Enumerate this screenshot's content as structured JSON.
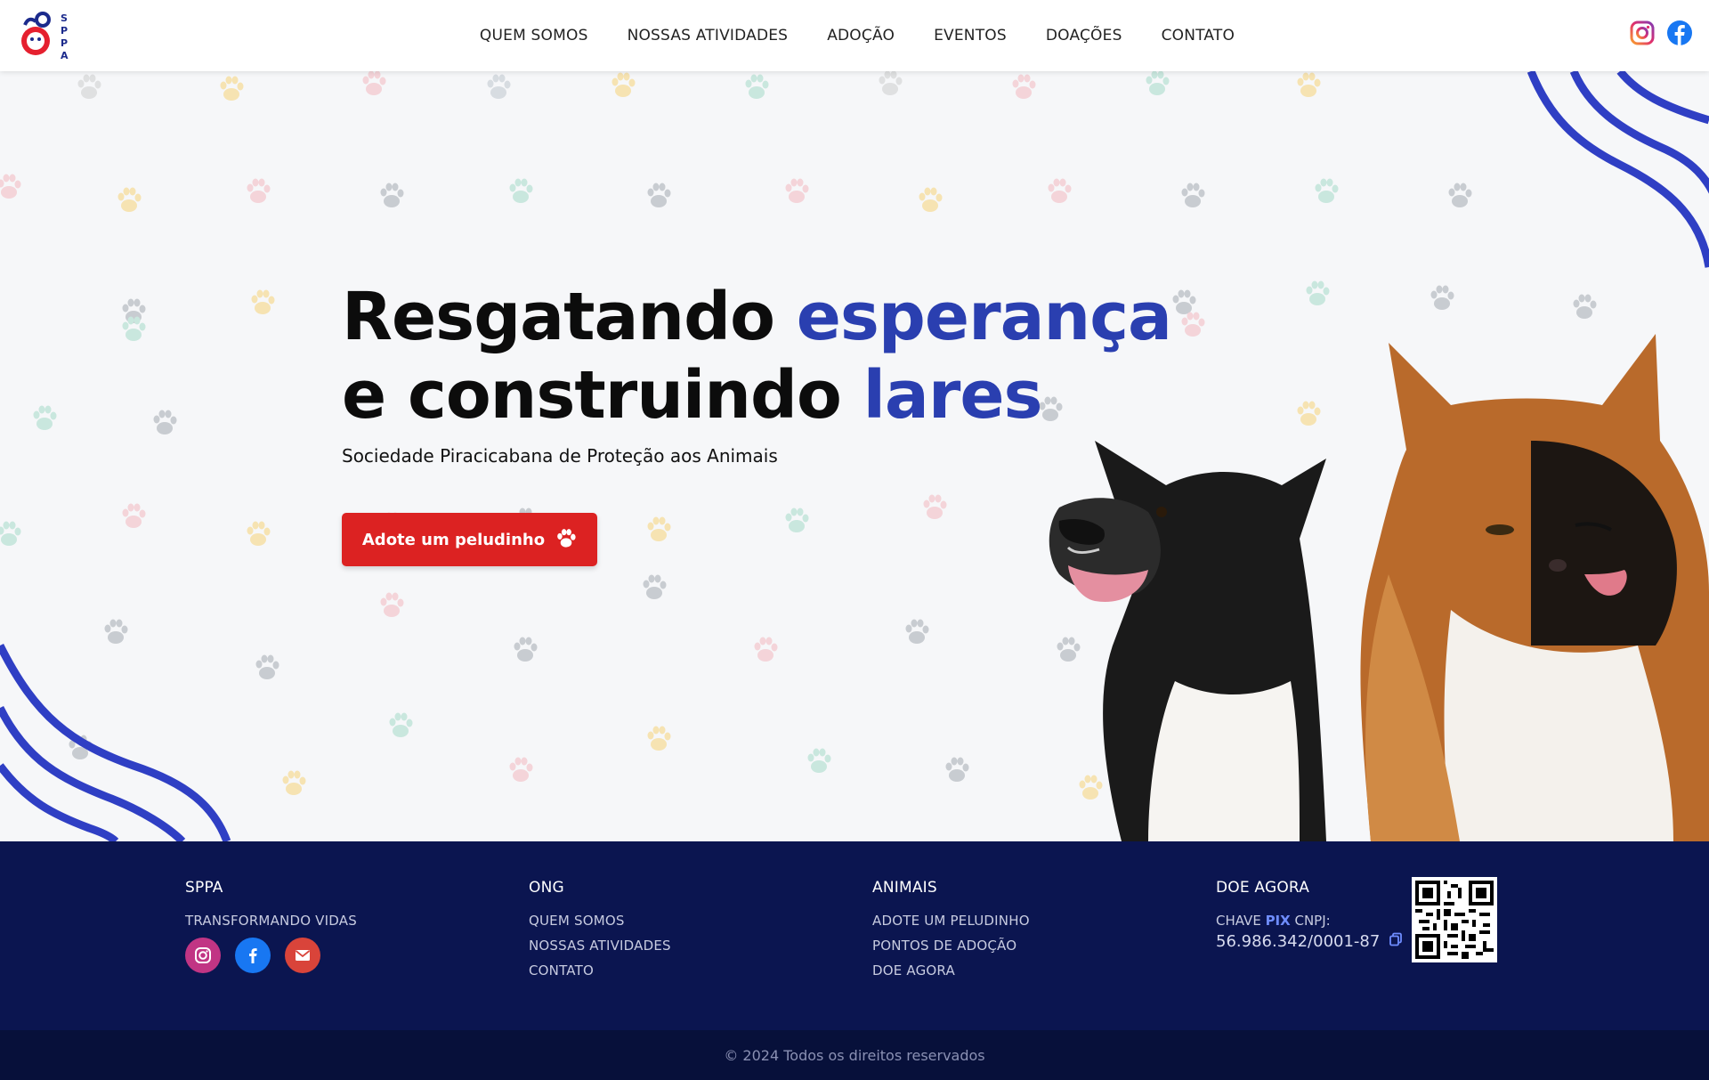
{
  "header": {
    "logo_letters": "SPPA",
    "nav": [
      {
        "label": "QUEM SOMOS"
      },
      {
        "label": "NOSSAS ATIVIDADES"
      },
      {
        "label": "ADOÇÃO"
      },
      {
        "label": "EVENTOS"
      },
      {
        "label": "DOAÇÕES"
      },
      {
        "label": "CONTATO"
      }
    ],
    "social": [
      "instagram-icon",
      "facebook-icon"
    ]
  },
  "hero": {
    "title_part1": "Resgatando ",
    "title_accent1": "esperança",
    "title_part2": "e construindo ",
    "title_accent2": "lares",
    "subtitle": "Sociedade Piracicabana de Proteção aos Animais",
    "cta_label": "Adote um peludinho",
    "accent_color": "#2a3fb0",
    "cta_color": "#dc2222"
  },
  "footer": {
    "col1": {
      "title": "SPPA",
      "tagline": "TRANSFORMANDO VIDAS",
      "social": [
        "instagram-icon",
        "facebook-icon",
        "email-icon"
      ]
    },
    "col2": {
      "title": "ONG",
      "items": [
        "QUEM SOMOS",
        "NOSSAS ATIVIDADES",
        "CONTATO"
      ]
    },
    "col3": {
      "title": "ANIMAIS",
      "items": [
        "ADOTE UM PELUDINHO",
        "PONTOS DE ADOÇÃO",
        "DOE AGORA"
      ]
    },
    "col4": {
      "title": "DOE AGORA",
      "pix_prefix": "CHAVE ",
      "pix_word": "PIX",
      "pix_suffix": " CNPJ:",
      "cnpj": "56.986.342/0001-87"
    },
    "copyright": "© 2024 Todos os direitos reservados",
    "background": "#0b1550"
  }
}
